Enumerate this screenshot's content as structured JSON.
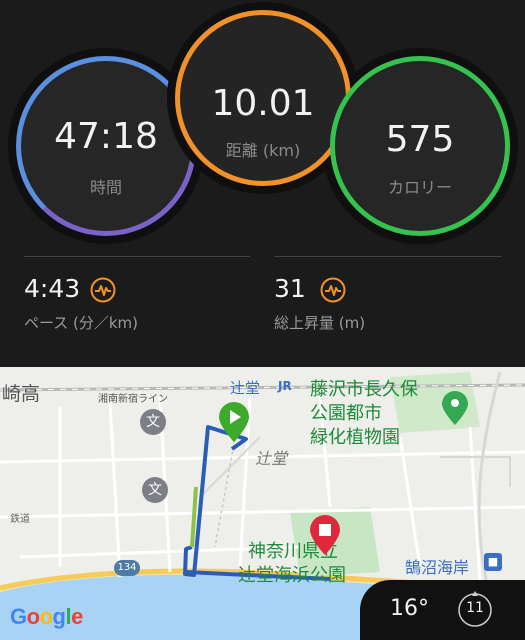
{
  "stats": {
    "time": {
      "value": "47:18",
      "label": "時間"
    },
    "distance": {
      "value": "10.01",
      "label": "距離 (km)"
    },
    "calories": {
      "value": "575",
      "label": "カロリー"
    },
    "pace": {
      "value": "4:43",
      "label": "ペース (分／km)"
    },
    "ascent": {
      "value": "31",
      "label": "総上昇量 (m)"
    },
    "colors": {
      "time": "#6a6fd0",
      "distance": "#f0912a",
      "calories": "#36c24f",
      "badge": "#f0912a"
    }
  },
  "map": {
    "labels": {
      "city_left": "崎高",
      "rail_line": "湘南新宿ライン",
      "station": "辻堂",
      "jr": "JR",
      "park_line1": "藤沢市長久保",
      "park_line2": "公園都市",
      "park_line3": "緑化植物園",
      "area": "辻堂",
      "rail_small": "鉄道",
      "beach_park_line1": "神奈川県立",
      "beach_park_line2": "辻堂海浜公園",
      "kugenuma": "鵠沼海岸",
      "route_no": "134",
      "google": "Google"
    },
    "icons": [
      "start-flag-icon",
      "finish-pin-icon",
      "school-icon",
      "park-icon",
      "train-station-icon"
    ]
  },
  "weather": {
    "temperature": "16°",
    "wind": "11"
  }
}
